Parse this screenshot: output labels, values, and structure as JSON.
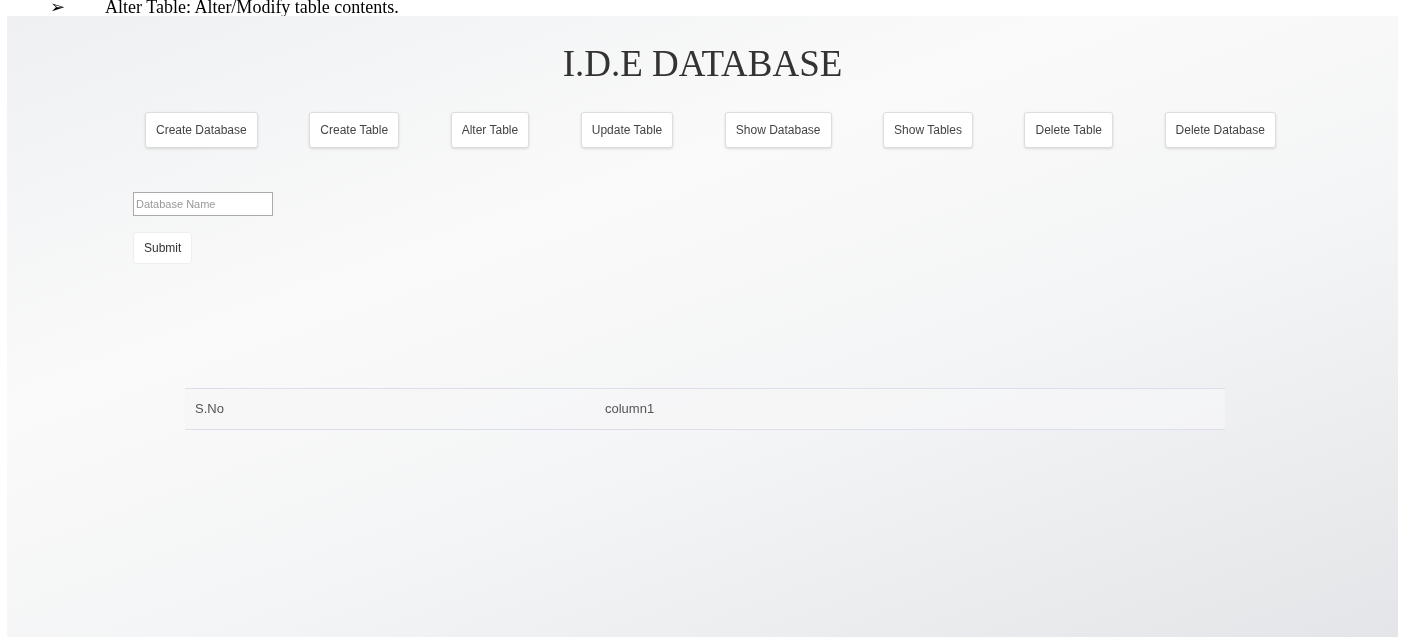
{
  "document_line": {
    "bullet": "➢",
    "text": "Alter Table: Alter/Modify table contents."
  },
  "page": {
    "title": "I.D.E DATABASE",
    "buttons": [
      "Create Database",
      "Create Table",
      "Alter Table",
      "Update Table",
      "Show Database",
      "Show Tables",
      "Delete Table",
      "Delete Database"
    ],
    "form": {
      "placeholder": "Database Name",
      "submit": "Submit"
    },
    "table": {
      "columns": [
        "S.No",
        "column1"
      ]
    }
  }
}
